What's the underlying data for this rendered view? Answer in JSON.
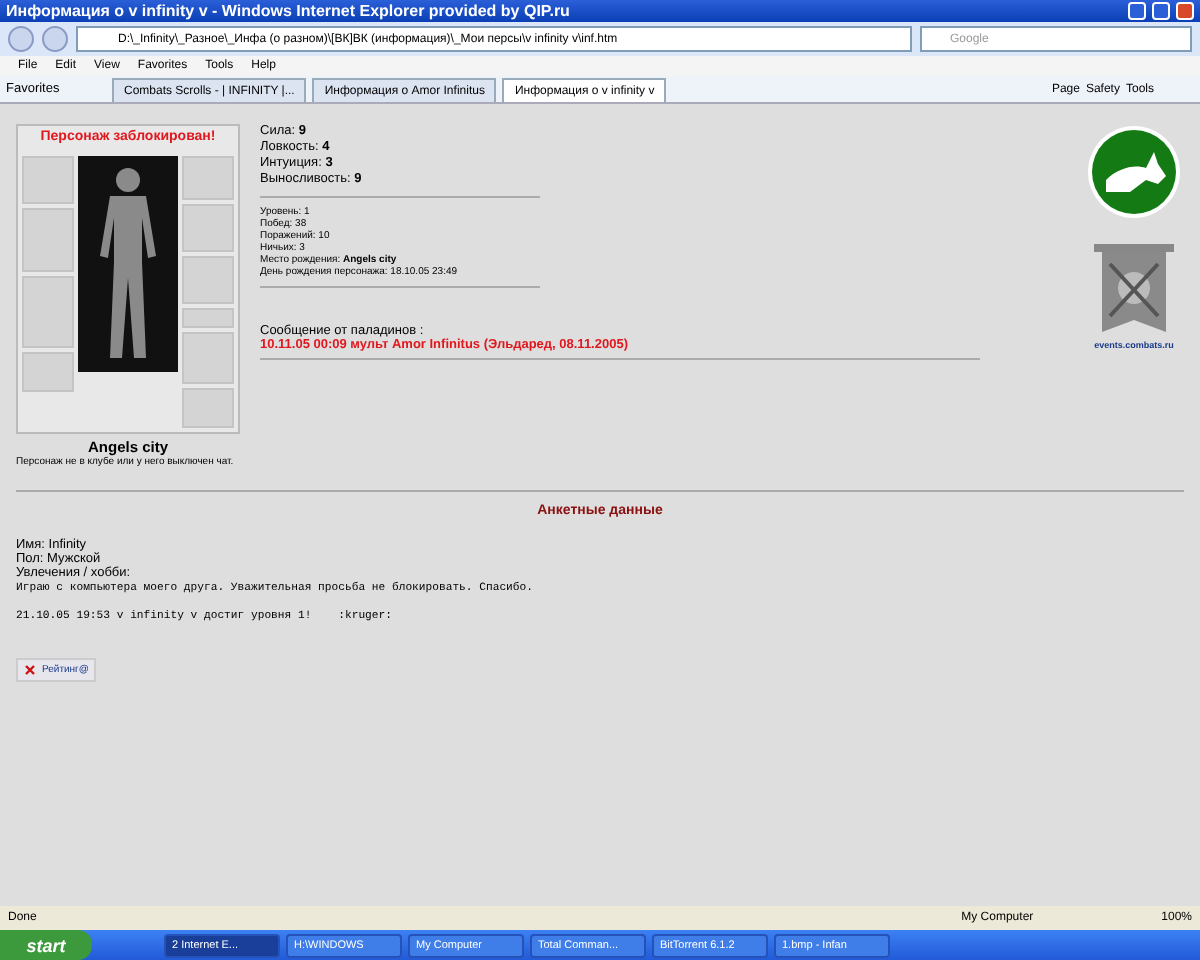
{
  "window": {
    "title": "Информация о v infinity v - Windows Internet Explorer provided by QIP.ru"
  },
  "address_bar": {
    "value": "D:\\_Infinity\\_Разное\\_Инфа (о разном)\\[ВК]ВК (информация)\\_Мои персы\\v infinity v\\inf.htm",
    "search_placeholder": "Google"
  },
  "menu": [
    "File",
    "Edit",
    "View",
    "Favorites",
    "Tools",
    "Help"
  ],
  "favorites_label": "Favorites",
  "tabs": [
    {
      "label": "Combats Scrolls - | INFINITY |...",
      "selected": false
    },
    {
      "label": "Информация о Amor Infinitus",
      "selected": false
    },
    {
      "label": "Информация о v infinity v",
      "selected": true
    }
  ],
  "command_bar": [
    "Page",
    "Safety",
    "Tools"
  ],
  "character": {
    "blocked_title": "Персонаж заблокирован!",
    "name": "Angels city",
    "note": "Персонаж не в клубе или у него выключен чат."
  },
  "stats": [
    "Сила: **9**",
    "Ловкость: **4**",
    "Интуиция: **3**",
    "Выносливость: **9**"
  ],
  "details": [
    "Уровень: 1",
    "Побед: 38",
    "Поражений: 10",
    "Ничьих: 3",
    "Место рождения: **Angels city**",
    "День рождения персонажа: 18.10.05 23:49"
  ],
  "message": {
    "heading": "Сообщение от паладинов :",
    "text": "10.11.05 00:09 мульт Amor Infinitus (Эльдаред, 08.11.2005)"
  },
  "logo_caption": "events.combats.ru",
  "profile": {
    "title": "Анкетные данные",
    "lines": [
      "Имя: Infinity",
      "Пол: Мужской",
      "Увлечения / хобби:"
    ],
    "mono_lines": [
      "Играю с компьютера моего друга. Уважительная просьба не блокировать. Спасибо.",
      "21.10.05 19:53 v infinity v достиг уровня 1!    :kruger:"
    ]
  },
  "rating_button": "Рейтинг@",
  "status_bar": {
    "text": "Done",
    "zone": "My Computer",
    "zoom": "100%"
  },
  "taskbar": {
    "start": "start",
    "items": [
      {
        "label": "2 Internet E...",
        "selected": true
      },
      {
        "label": "H:\\WINDOWS",
        "selected": false
      },
      {
        "label": "My Computer",
        "selected": false
      },
      {
        "label": "Total Comman...",
        "selected": false
      },
      {
        "label": "BitTorrent 6.1.2",
        "selected": false
      },
      {
        "label": "1.bmp - Infan",
        "selected": false
      }
    ]
  }
}
